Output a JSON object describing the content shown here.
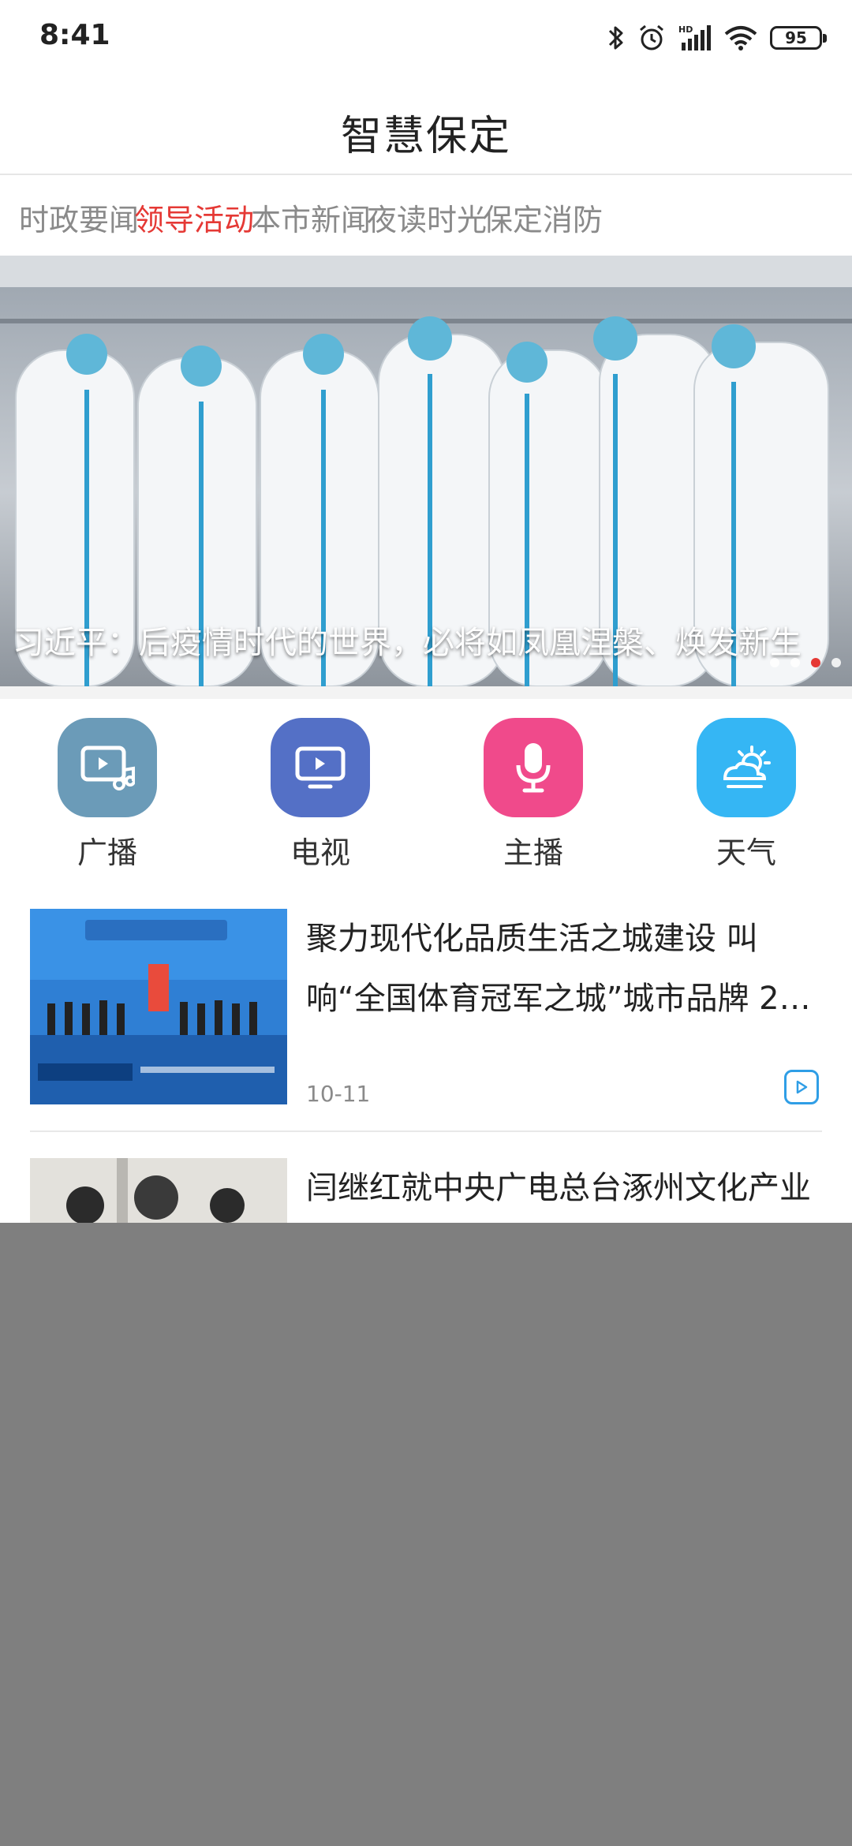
{
  "status": {
    "time": "8:41",
    "battery": "95",
    "icons": [
      "bluetooth-icon",
      "alarm-icon",
      "hd-signal-icon",
      "wifi-icon",
      "battery-icon"
    ]
  },
  "header": {
    "title": "智慧保定"
  },
  "tabs": [
    {
      "label": "时政要闻",
      "active": false
    },
    {
      "label": "领导活动",
      "active": true
    },
    {
      "label": "本市新闻",
      "active": false
    },
    {
      "label": "夜读时光",
      "active": false
    },
    {
      "label": "保定消防",
      "active": false
    }
  ],
  "banner": {
    "caption": "习近平：后疫情时代的世界，必将如凤凰涅槃、焕发新生",
    "slide_count": 4,
    "active_slide": 3
  },
  "quick": [
    {
      "label": "广播",
      "icon": "radio-music-icon",
      "color": "#6b9bb8"
    },
    {
      "label": "电视",
      "icon": "tv-icon",
      "color": "#5470c6"
    },
    {
      "label": "主播",
      "icon": "microphone-icon",
      "color": "#f04a8b"
    },
    {
      "label": "天气",
      "icon": "weather-icon",
      "color": "#35b6f4"
    }
  ],
  "news": [
    {
      "title": "聚力现代化品质生活之城建设 叫响“全国体育冠军之城”城市品牌 2…",
      "date": "10-11",
      "has_video": true
    },
    {
      "title": "闫继红就中央广电总台涿州文化产业综合项目进",
      "date": "",
      "has_video": false
    }
  ],
  "colors": {
    "accent": "#e53935",
    "overlay": "#7f7f7f",
    "video_badge": "#2f9ee6"
  }
}
